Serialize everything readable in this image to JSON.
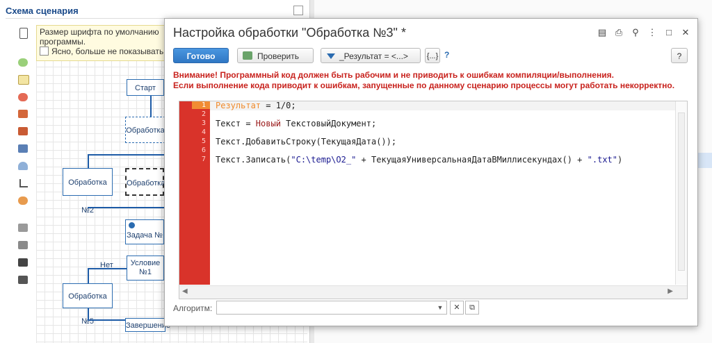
{
  "bg": {
    "panel_title": "Схема сценария",
    "tip_text": "Размер шрифта по умолчанию",
    "tip_text2": "программы.",
    "tip_checkbox": "Ясно, больше не показывать",
    "nodes": {
      "start": "Старт",
      "proc": "Обработка",
      "proc2": "Обработка №2",
      "proc3": "Обработка",
      "task": "Задача №",
      "cond": "Условие",
      "cond2": "№1",
      "no": "Нет",
      "proc5": "Обработка №5",
      "end": "Завершение"
    }
  },
  "dialog": {
    "title": "Настройка обработки \"Обработка №3\" *",
    "toolbar": {
      "done": "Готово",
      "check": "Проверить",
      "result": "_Результат = <...>",
      "braces": "{...}",
      "help_q": "?",
      "help_btn": "?"
    },
    "warning_line1": "Внимание! Программный код должен быть рабочим и не приводить к ошибкам компиляции/выполнения.",
    "warning_line2": "Если выполнение кода приводит к ошибкам, запущенные по данному сценарию процессы могут работать некорректно.",
    "line_numbers": [
      "1",
      "2",
      "3",
      "4",
      "5",
      "6",
      "7"
    ],
    "code": {
      "l1a": "Результат",
      "l1b": " = 1/0;",
      "l3a": "Текст = ",
      "l3b": "Новый",
      "l3c": " ТекстовыйДокумент;",
      "l5": "Текст.ДобавитьСтроку(ТекущаяДата());",
      "l7a": "Текст.Записать(",
      "l7b": "\"C:\\temp\\O2_\"",
      "l7c": " + ТекущаяУниверсальнаяДатаВМиллисекундах() + ",
      "l7d": "\".txt\"",
      "l7e": ")"
    },
    "algo_label": "Алгоритм:",
    "algo_value": ""
  }
}
